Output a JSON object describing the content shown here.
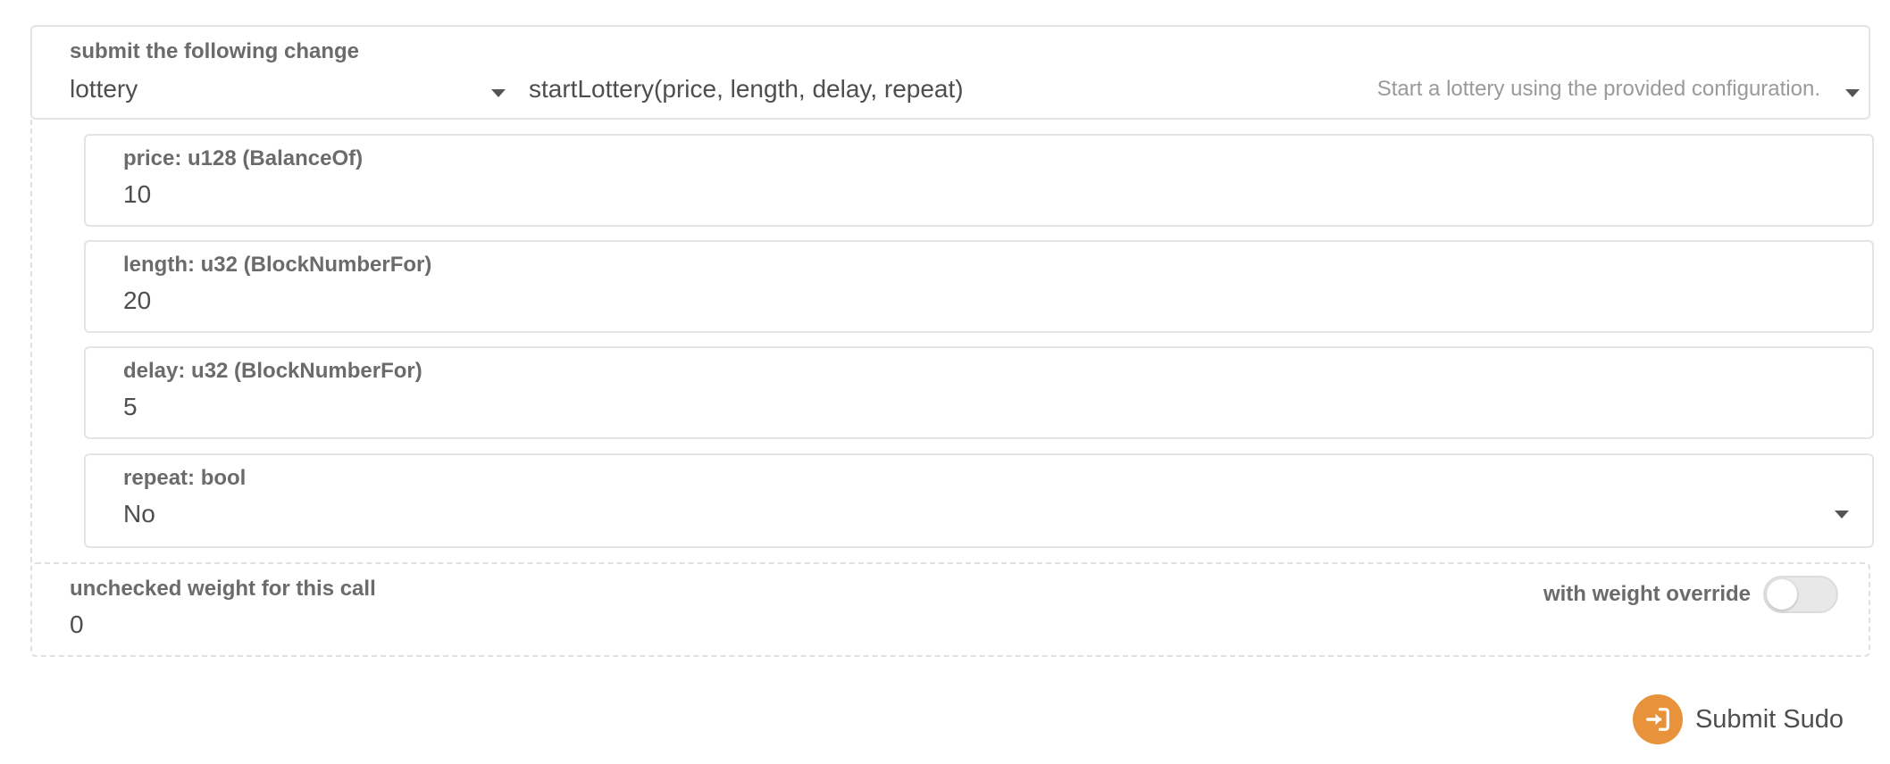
{
  "call": {
    "label": "submit the following change",
    "module": "lottery",
    "method": "startLottery(price, length, delay, repeat)",
    "method_description": "Start a lottery using the provided configuration."
  },
  "params": [
    {
      "label": "price: u128 (BalanceOf)",
      "value": "10"
    },
    {
      "label": "length: u32 (BlockNumberFor)",
      "value": "20"
    },
    {
      "label": "delay: u32 (BlockNumberFor)",
      "value": "5"
    },
    {
      "label": "repeat: bool",
      "value": "No"
    }
  ],
  "weight": {
    "label": "unchecked weight for this call",
    "value": "0",
    "override_label": "with weight override",
    "override_enabled": false
  },
  "submit": {
    "label": "Submit Sudo",
    "icon": "sign-in-icon",
    "color": "#e8933b"
  }
}
